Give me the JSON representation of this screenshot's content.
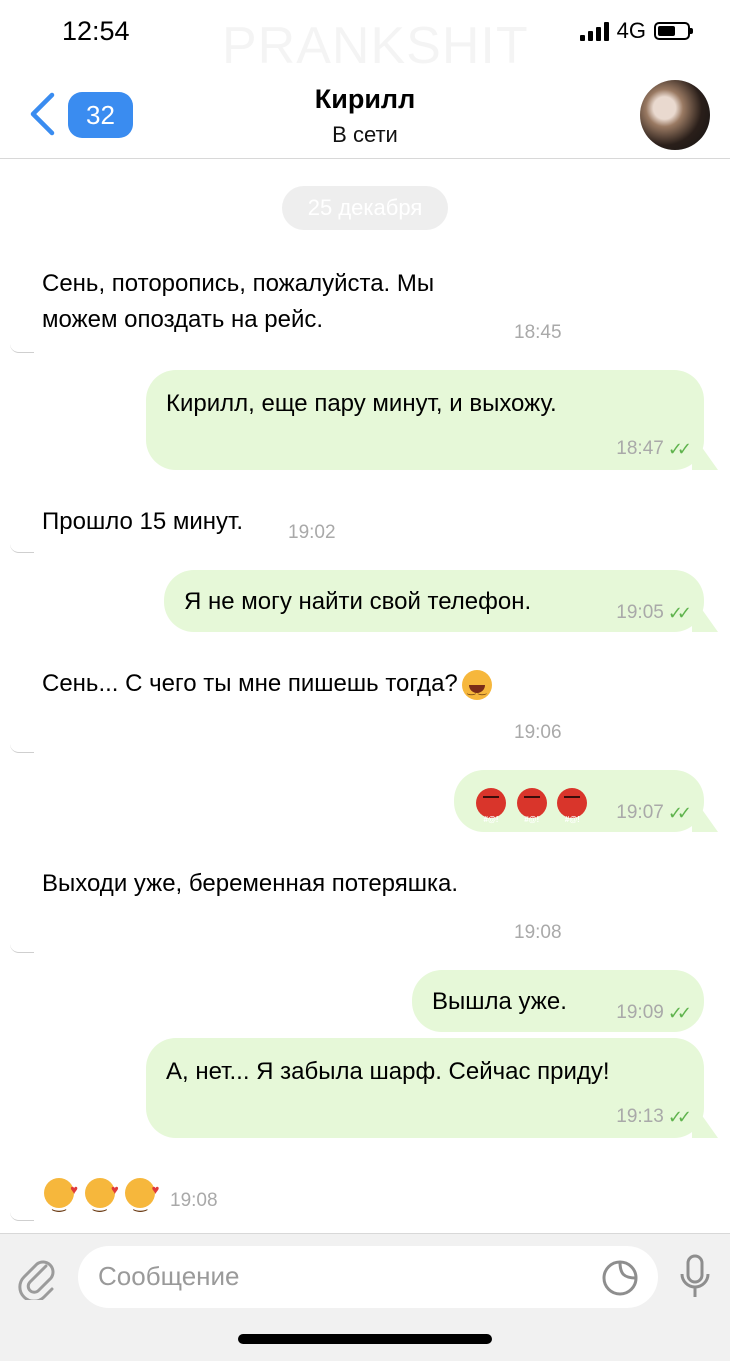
{
  "status_bar": {
    "time": "12:54",
    "network": "4G",
    "signal_bars": 4,
    "battery_level": 0.6
  },
  "watermark": "PRANKSHIT",
  "header": {
    "unread_count": "32",
    "contact_name": "Кирилл",
    "presence": "В сети"
  },
  "chat": {
    "date_label": "25 декабря",
    "messages": [
      {
        "direction": "in",
        "text_lines": [
          "Сень, поторопись, пожалуйста. Мы",
          "можем опоздать на рейс."
        ],
        "time": "18:45"
      },
      {
        "direction": "out",
        "text": "Кирилл, еще пару минут, и выхожу.",
        "time": "18:47",
        "status": "read"
      },
      {
        "direction": "in",
        "text": "Прошло 15 минут.",
        "time": "19:02"
      },
      {
        "direction": "out",
        "text": "Я не могу найти свой телефон.",
        "time": "19:05",
        "status": "read"
      },
      {
        "direction": "in",
        "text": "Сень... С чего ты мне пишешь тогда?",
        "emoji": "face-with-tears-of-joy",
        "time": "19:06"
      },
      {
        "direction": "out",
        "emoji": "face-with-symbols-on-mouth x3",
        "time": "19:07",
        "status": "read"
      },
      {
        "direction": "in",
        "text": "Выходи уже, беременная потеряшка.",
        "time": "19:08"
      },
      {
        "direction": "out",
        "text": "Вышла уже.",
        "time": "19:09",
        "status": "read"
      },
      {
        "direction": "out",
        "text": "А, нет... Я забыла шарф. Сейчас приду!",
        "time": "19:13",
        "status": "read"
      },
      {
        "direction": "in",
        "emoji": "smiling-face-with-hearts x3",
        "time": "19:08"
      }
    ]
  },
  "input": {
    "placeholder": "Сообщение"
  },
  "colors": {
    "accent": "#3a8cf0",
    "outgoing_bubble": "#e6f8d8",
    "read_check": "#5fb34d",
    "timestamp": "#a9a9a9"
  },
  "icons": [
    "chevron-left-icon",
    "paperclip-icon",
    "sticker-icon",
    "microphone-icon",
    "double-check-icon"
  ]
}
